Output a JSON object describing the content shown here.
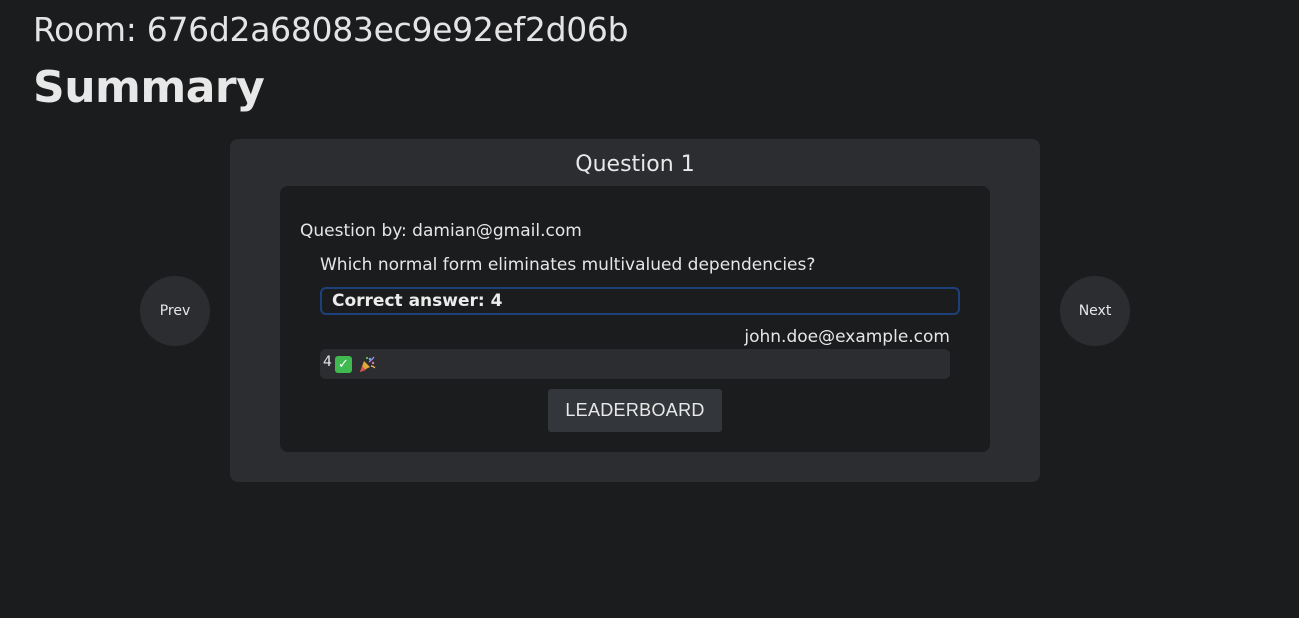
{
  "header": {
    "room_label": "Room: 676d2a68083ec9e92ef2d06b",
    "page_title": "Summary"
  },
  "navigation": {
    "prev_label": "Prev",
    "next_label": "Next"
  },
  "question": {
    "heading": "Question 1",
    "author_text": "Question by: damian@gmail.com",
    "text": "Which normal form eliminates multivalued dependencies?",
    "correct_answer_text": "Correct answer: 4"
  },
  "responses": [
    {
      "email": "john.doe@example.com",
      "answer": "4",
      "status_icon": "check-icon",
      "celebration_icon": "party-popper-icon"
    }
  ],
  "actions": {
    "leaderboard_label": "LEADERBOARD"
  },
  "colors": {
    "background": "#1b1c1e",
    "card": "#2b2d30",
    "answer_border": "#1d3f7a",
    "correct": "#3fb950"
  }
}
